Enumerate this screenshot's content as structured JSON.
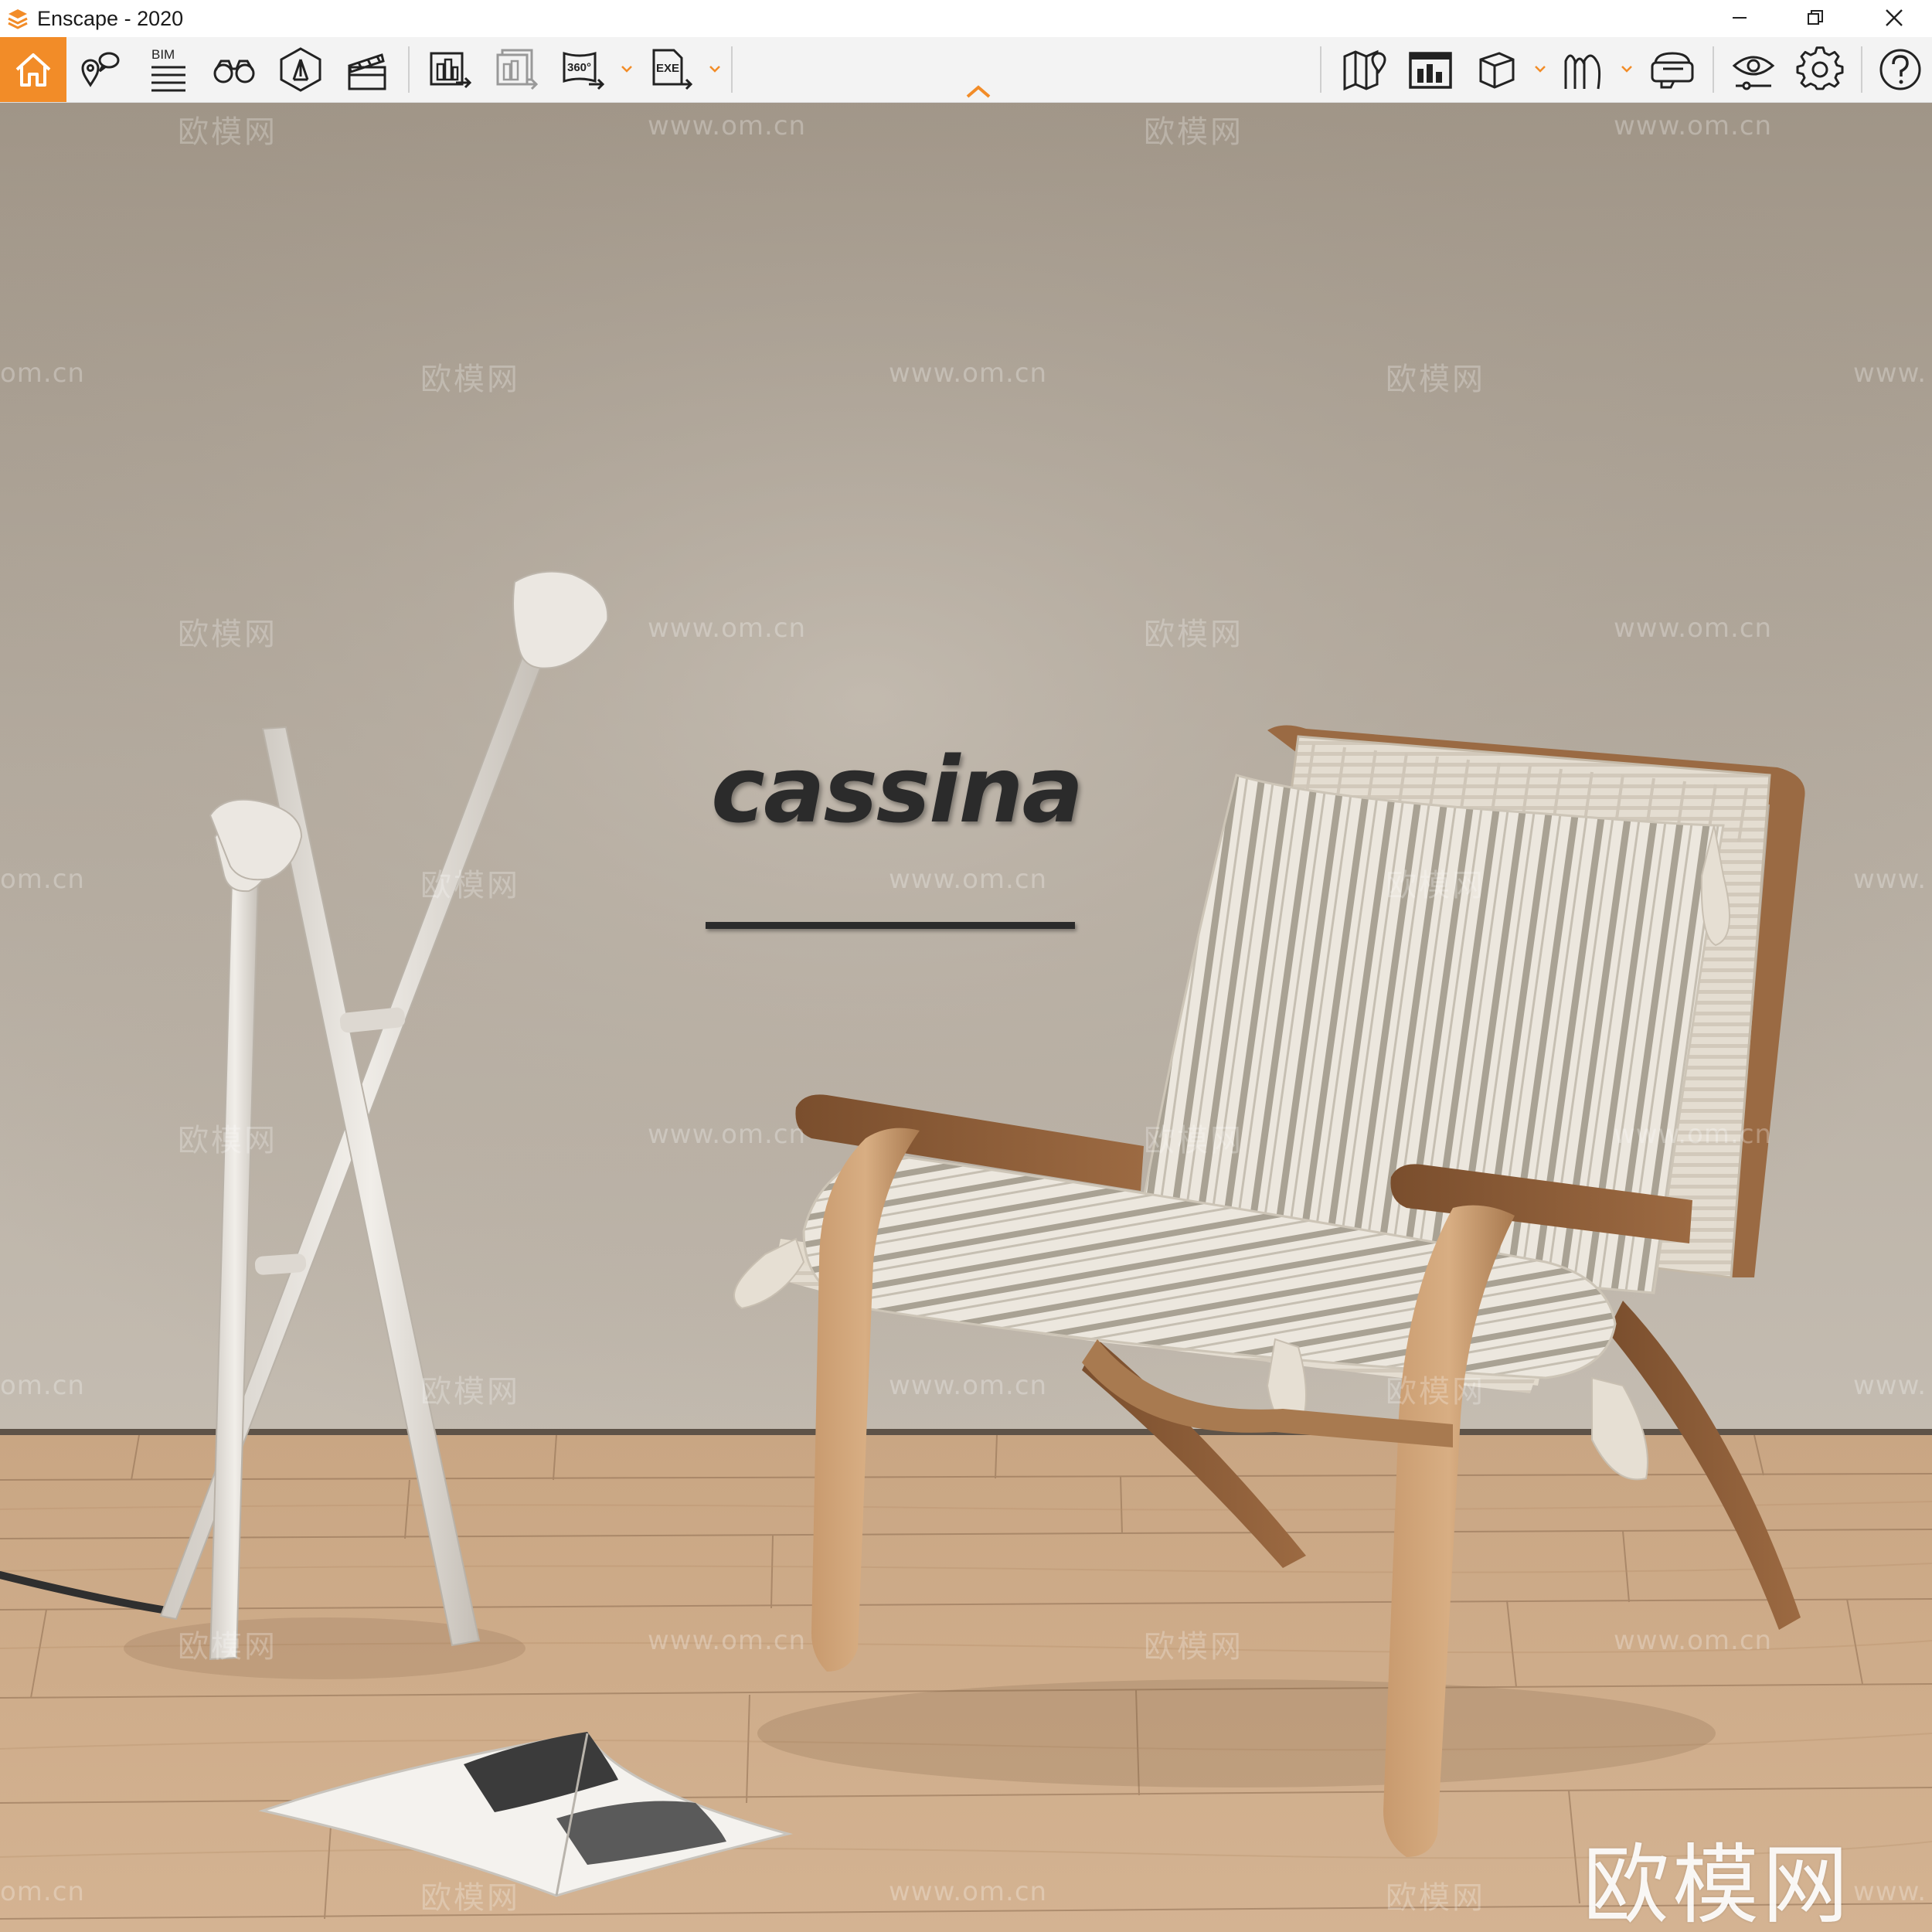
{
  "window": {
    "title": "Enscape - 2020",
    "controls": [
      "minimize",
      "restore",
      "close"
    ]
  },
  "toolbar": {
    "accent_color": "#f28c28",
    "bim_label": "BIM",
    "panorama_label": "360°",
    "exe_label": "EXE",
    "left_tools": [
      "home-icon",
      "location-pin-icon",
      "bim-info-icon",
      "binoculars-icon",
      "view-management-icon",
      "clapperboard-icon"
    ],
    "export_tools": [
      "render-export-icon",
      "batch-render-icon",
      "panorama-export-icon",
      "exe-export-icon"
    ],
    "right_tools": [
      "map-icon",
      "screenshot-icon",
      "cube-view-icon",
      "asset-library-icon",
      "vr-headset-icon",
      "visual-settings-icon",
      "gear-icon",
      "help-icon"
    ]
  },
  "scene": {
    "brand_sign": "cassina",
    "watermark_cn": "欧模网",
    "watermark_url": "www.om.cn",
    "watermark_url_partial": "om.cn",
    "watermark_url_cut": "www.",
    "corner_watermark": "欧模网"
  }
}
